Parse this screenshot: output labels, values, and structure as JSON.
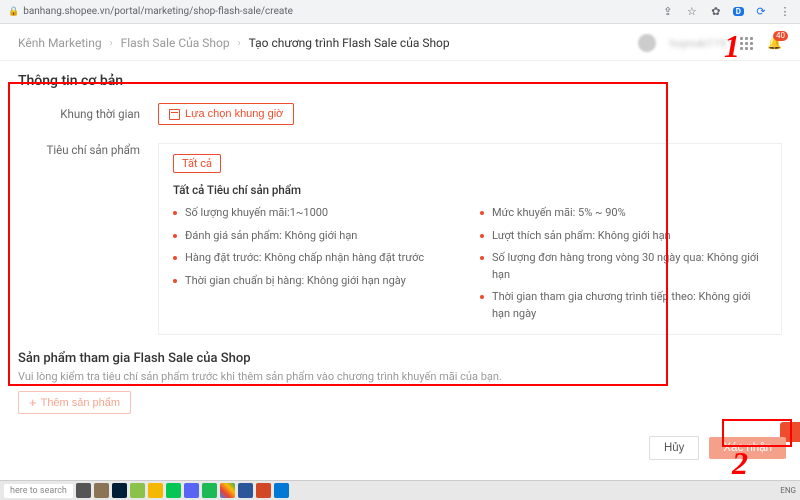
{
  "browser": {
    "url": "banhang.shopee.vn/portal/marketing/shop-flash-sale/create",
    "bell_badge": "40"
  },
  "breadcrumb": {
    "item1": "Kênh Marketing",
    "item2": "Flash Sale Của Shop",
    "current": "Tạo chương trình Flash Sale của Shop"
  },
  "header": {
    "username": "huynuki119"
  },
  "basic_info": {
    "section_title": "Thông tin cơ bản",
    "time_label": "Khung thời gian",
    "time_button": "Lựa chọn khung giờ",
    "criteria_label": "Tiêu chí sản phẩm",
    "all_tag": "Tất cả",
    "criteria_title": "Tất cả Tiêu chí sản phẩm",
    "left": [
      "Số lượng khuyến mãi:1~1000",
      "Đánh giá sản phẩm: Không giới hạn",
      "Hàng đặt trước: Không chấp nhận hàng đặt trước",
      "Thời gian chuẩn bị hàng: Không giới hạn ngày"
    ],
    "right": [
      "Mức khuyến mãi: 5% ~ 90%",
      "Lượt thích sản phẩm: Không giới hạn",
      "Số lượng đơn hàng trong vòng 30 ngày qua: Không giới hạn",
      "Thời gian tham gia chương trình tiếp theo: Không giới hạn ngày"
    ]
  },
  "products": {
    "title": "Sản phẩm tham gia Flash Sale của Shop",
    "hint": "Vui lòng kiểm tra tiêu chí sản phẩm trước khi thêm sản phẩm vào chương trình khuyến mãi của bạn.",
    "add_button": "Thêm sản phẩm"
  },
  "footer": {
    "cancel": "Hủy",
    "confirm": "Xác nhận"
  },
  "taskbar": {
    "search": "here to search",
    "lang": "ENG"
  },
  "annotations": {
    "one": "1",
    "two": "2"
  }
}
